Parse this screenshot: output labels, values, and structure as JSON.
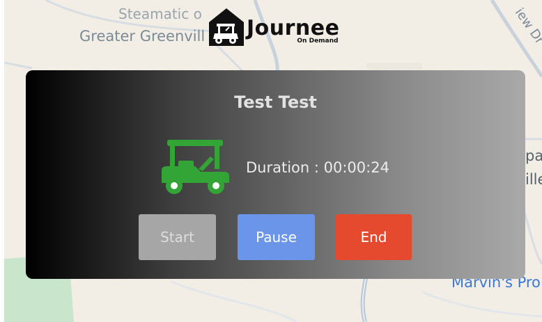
{
  "map": {
    "labels": [
      "Steamatic o",
      "Greater Greenvill",
      "iew Dr",
      "pa",
      "ille",
      "Marvin's Pro"
    ]
  },
  "logo": {
    "text": "Journee",
    "subtext": "On Demand"
  },
  "trip_card": {
    "rider_name": "Test Test",
    "duration_text": "Duration : 00:00:24",
    "icon": "golf-cart-icon",
    "buttons": {
      "start": "Start",
      "pause": "Pause",
      "end": "End"
    }
  },
  "colors": {
    "cart_icon": "#33a537",
    "start_button": "#a6a6a6",
    "pause_button": "#6a95e8",
    "end_button": "#e54a2e",
    "map_background": "#f2eee6"
  }
}
